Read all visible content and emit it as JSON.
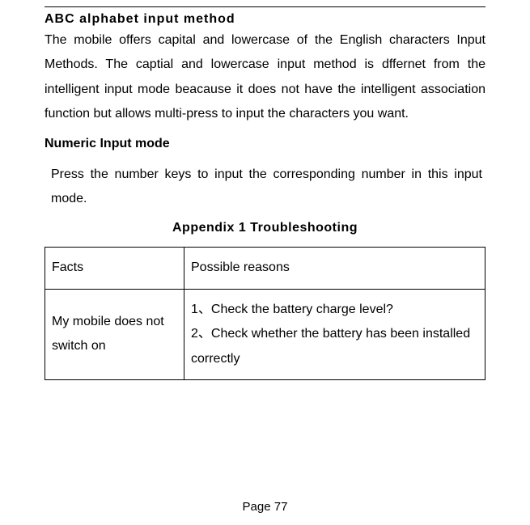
{
  "heading1": "ABC alphabet input method",
  "para1": "The mobile offers capital and lowercase of the English characters Input Methods. The captial and lowercase input method is dffernet from the intelligent input mode beacause it does not have the intelligent association function but allows multi-press to input the characters you want.",
  "heading2": "Numeric Input mode",
  "para2": "Press the number keys to input the corresponding number in this input mode.",
  "appendix_title": "Appendix 1    Troubleshooting",
  "table": {
    "header": {
      "facts": "Facts",
      "reasons": "Possible reasons"
    },
    "rows": [
      {
        "fact": "My mobile does not switch on",
        "reason": "1、Check the battery charge level?\n2、Check whether the battery has been installed correctly"
      }
    ]
  },
  "page_label": "Page 77"
}
